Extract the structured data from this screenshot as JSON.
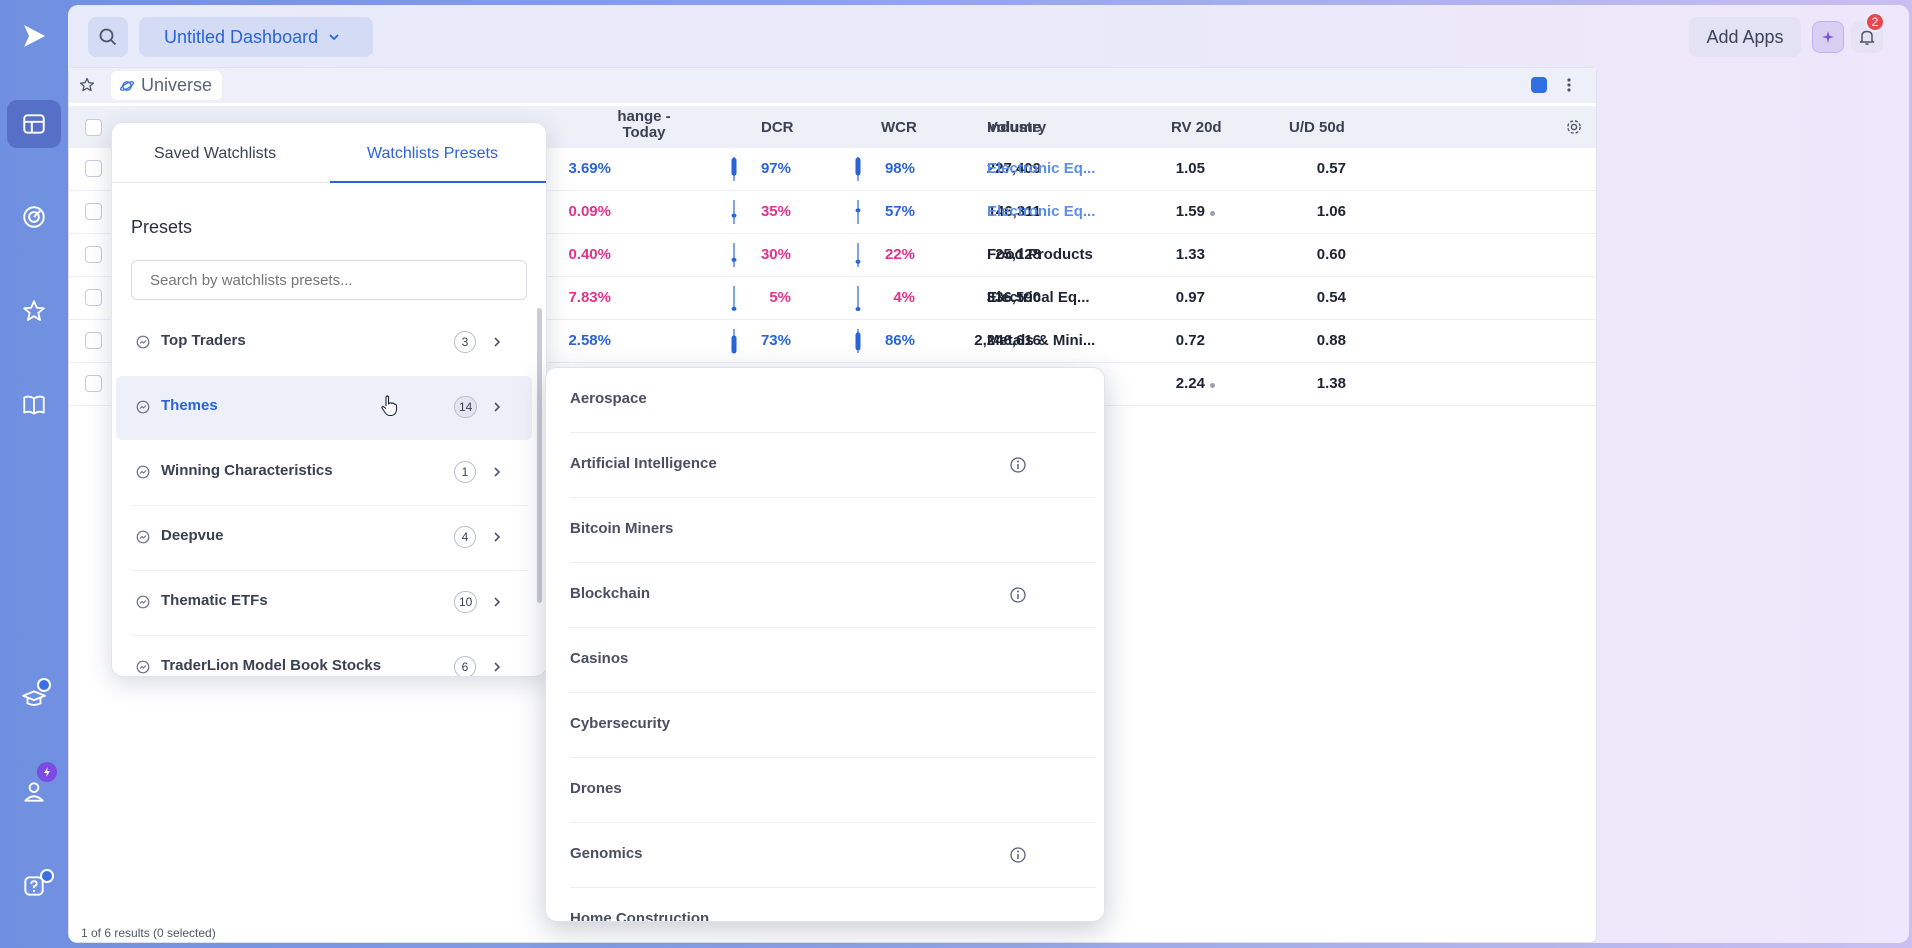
{
  "topbar": {
    "dashboard_title": "Untitled Dashboard",
    "add_apps_label": "Add Apps",
    "notification_count": "2"
  },
  "widget": {
    "name": "Universe",
    "footer": "1 of 6 results (0 selected)",
    "color": "#2f6fe0"
  },
  "table": {
    "columns": {
      "change": "hange - Today",
      "dcr": "DCR",
      "wcr": "WCR",
      "volume": "Volume",
      "industry": "Industry",
      "rv": "RV 20d",
      "ud": "U/D 50d"
    },
    "rows": [
      {
        "change": "3.69%",
        "dir": "pos",
        "dcr": "97%",
        "dcr_dir": "pos",
        "wcr": "98%",
        "wcr_dir": "pos",
        "volume": "227,409",
        "industry": "Electronic Eq...",
        "ind_link": true,
        "rv": "1.05",
        "rv_dot": false,
        "ud": "0.57"
      },
      {
        "change": "0.09%",
        "dir": "neg",
        "dcr": "35%",
        "dcr_dir": "neg",
        "wcr": "57%",
        "wcr_dir": "pos",
        "volume": "146,311",
        "industry": "Electronic Eq...",
        "ind_link": true,
        "rv": "1.59",
        "rv_dot": true,
        "ud": "1.06"
      },
      {
        "change": "0.40%",
        "dir": "neg",
        "dcr": "30%",
        "dcr_dir": "neg",
        "wcr": "22%",
        "wcr_dir": "neg",
        "volume": "25,128",
        "industry": "Food Products",
        "ind_link": false,
        "rv": "1.33",
        "rv_dot": false,
        "ud": "0.60"
      },
      {
        "change": "7.83%",
        "dir": "neg",
        "dcr": "5%",
        "dcr_dir": "neg",
        "wcr": "4%",
        "wcr_dir": "neg",
        "volume": "336,590",
        "industry": "Electrical Eq...",
        "ind_link": false,
        "rv": "0.97",
        "rv_dot": false,
        "ud": "0.54"
      },
      {
        "change": "2.58%",
        "dir": "pos",
        "dcr": "73%",
        "dcr_dir": "pos",
        "wcr": "86%",
        "wcr_dir": "pos",
        "volume": "2,246,616",
        "industry": "Metals & Mini...",
        "ind_link": false,
        "rv": "0.72",
        "rv_dot": false,
        "ud": "0.88"
      },
      {
        "change": "",
        "dir": "pos",
        "dcr": "",
        "dcr_dir": "pos",
        "wcr": "",
        "wcr_dir": "pos",
        "volume": "",
        "industry": "",
        "ind_link": false,
        "rv": "2.24",
        "rv_dot": true,
        "ud": "1.38"
      }
    ]
  },
  "presets_panel": {
    "tabs": [
      "Saved Watchlists",
      "Watchlists Presets"
    ],
    "active_tab": 1,
    "heading": "Presets",
    "search_placeholder": "Search by watchlists presets...",
    "items": [
      {
        "label": "Top Traders",
        "count": "3"
      },
      {
        "label": "Themes",
        "count": "14",
        "highlighted": true
      },
      {
        "label": "Winning Characteristics",
        "count": "1"
      },
      {
        "label": "Deepvue",
        "count": "4"
      },
      {
        "label": "Thematic ETFs",
        "count": "10"
      },
      {
        "label": "TraderLion Model Book Stocks",
        "count": "6"
      }
    ]
  },
  "themes_panel": {
    "items": [
      {
        "label": "Aerospace",
        "info": false
      },
      {
        "label": "Artificial Intelligence",
        "info": true
      },
      {
        "label": "Bitcoin Miners",
        "info": false
      },
      {
        "label": "Blockchain",
        "info": true
      },
      {
        "label": "Casinos",
        "info": false
      },
      {
        "label": "Cybersecurity",
        "info": false
      },
      {
        "label": "Drones",
        "info": false
      },
      {
        "label": "Genomics",
        "info": true
      },
      {
        "label": "Home Construction",
        "info": false
      }
    ]
  },
  "colors": {
    "accent": "#2b63d9",
    "negative": "#e0338a",
    "rail_active": "#5670c8"
  }
}
